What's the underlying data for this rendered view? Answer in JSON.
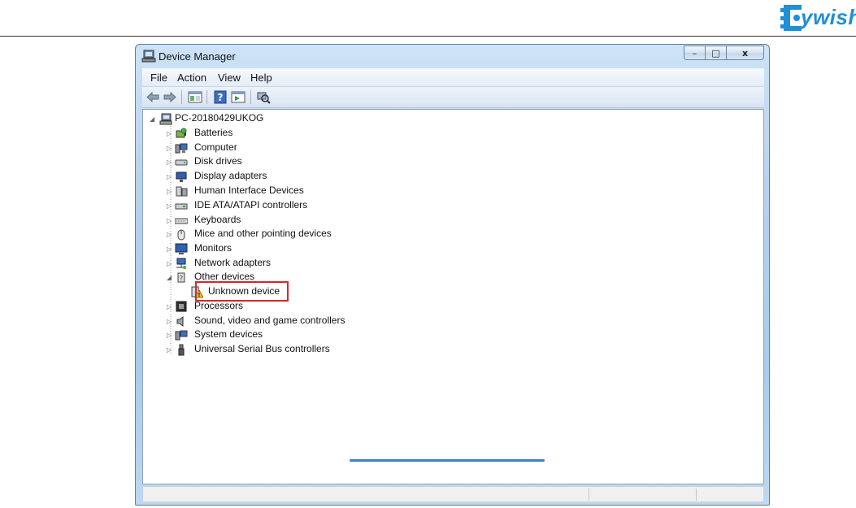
{
  "logo": {
    "text": "ywish",
    "brand_color": "#1f8fd8"
  },
  "window": {
    "title": "Device Manager",
    "caption": {
      "minimize": "–",
      "maximize": "□",
      "close": "x"
    }
  },
  "menu": [
    {
      "label": "File"
    },
    {
      "label": "Action"
    },
    {
      "label": "View"
    },
    {
      "label": "Help"
    }
  ],
  "toolbar": {
    "buttons": [
      "back-icon",
      "forward-icon",
      "properties-icon",
      "help-icon",
      "run-icon",
      "scan-hardware-icon"
    ]
  },
  "tree": {
    "root": "PC-20180429UKOG",
    "items": [
      {
        "label": "Batteries",
        "icon": "battery-icon",
        "expanded": false
      },
      {
        "label": "Computer",
        "icon": "computer-icon",
        "expanded": false
      },
      {
        "label": "Disk drives",
        "icon": "disk-drive-icon",
        "expanded": false
      },
      {
        "label": "Display adapters",
        "icon": "display-adapter-icon",
        "expanded": false
      },
      {
        "label": "Human Interface Devices",
        "icon": "hid-icon",
        "expanded": false
      },
      {
        "label": "IDE ATA/ATAPI controllers",
        "icon": "ide-controller-icon",
        "expanded": false
      },
      {
        "label": "Keyboards",
        "icon": "keyboard-icon",
        "expanded": false
      },
      {
        "label": "Mice and other pointing devices",
        "icon": "mouse-icon",
        "expanded": false
      },
      {
        "label": "Monitors",
        "icon": "monitor-icon",
        "expanded": false
      },
      {
        "label": "Network adapters",
        "icon": "network-adapter-icon",
        "expanded": false
      },
      {
        "label": "Other devices",
        "icon": "other-devices-icon",
        "expanded": true
      },
      {
        "label": "Unknown device",
        "icon": "warning-device-icon",
        "child": true
      },
      {
        "label": "Processors",
        "icon": "processor-icon",
        "expanded": false
      },
      {
        "label": "Sound, video and game controllers",
        "icon": "sound-icon",
        "expanded": false
      },
      {
        "label": "System devices",
        "icon": "system-devices-icon",
        "expanded": false
      },
      {
        "label": "Universal Serial Bus controllers",
        "icon": "usb-icon",
        "expanded": false
      }
    ]
  },
  "colors": {
    "highlight_border": "#d8262b",
    "warning": "#f2c21b"
  }
}
